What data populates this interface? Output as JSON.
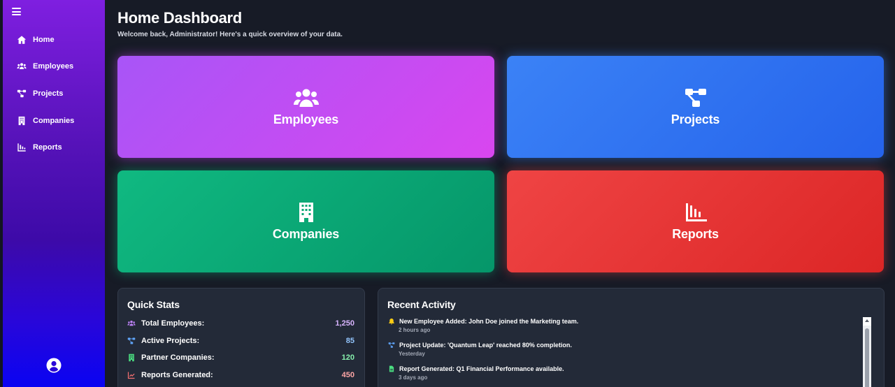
{
  "colors": {
    "sidebar_top": "#7f1fe0",
    "sidebar_bottom": "#0a04f2",
    "background": "#171b26",
    "panel": "#232a38",
    "employees_tile": "#c04af0",
    "projects_tile": "#3b82f6",
    "companies_tile": "#10b981",
    "reports_tile": "#ef4444"
  },
  "sidebar": {
    "menu_icon": "hamburger-icon",
    "items": [
      {
        "label": "Home",
        "icon": "home-icon"
      },
      {
        "label": "Employees",
        "icon": "users-icon"
      },
      {
        "label": "Projects",
        "icon": "project-diagram-icon"
      },
      {
        "label": "Companies",
        "icon": "building-icon"
      },
      {
        "label": "Reports",
        "icon": "chart-icon"
      }
    ],
    "user_icon": "user-circle-icon"
  },
  "header": {
    "title": "Home Dashboard",
    "subtitle": "Welcome back, Administrator! Here's a quick overview of your data."
  },
  "tiles": [
    {
      "label": "Employees",
      "icon": "users-icon"
    },
    {
      "label": "Projects",
      "icon": "project-diagram-icon"
    },
    {
      "label": "Companies",
      "icon": "building-icon"
    },
    {
      "label": "Reports",
      "icon": "chart-icon"
    }
  ],
  "quick_stats": {
    "title": "Quick Stats",
    "rows": [
      {
        "label": "Total Employees:",
        "value": "1,250",
        "color": "#d8b4fe"
      },
      {
        "label": "Active Projects:",
        "value": "85",
        "color": "#93c5fd"
      },
      {
        "label": "Partner Companies:",
        "value": "120",
        "color": "#86efac"
      },
      {
        "label": "Reports Generated:",
        "value": "450",
        "color": "#fca5a5"
      }
    ]
  },
  "recent_activity": {
    "title": "Recent Activity",
    "items": [
      {
        "text": "New Employee Added: John Doe joined the Marketing team.",
        "time": "2 hours ago",
        "icon": "bell-icon"
      },
      {
        "text": "Project Update: 'Quantum Leap' reached 80% completion.",
        "time": "Yesterday",
        "icon": "project-diagram-icon"
      },
      {
        "text": "Report Generated: Q1 Financial Performance available.",
        "time": "3 days ago",
        "icon": "file-icon"
      }
    ]
  }
}
